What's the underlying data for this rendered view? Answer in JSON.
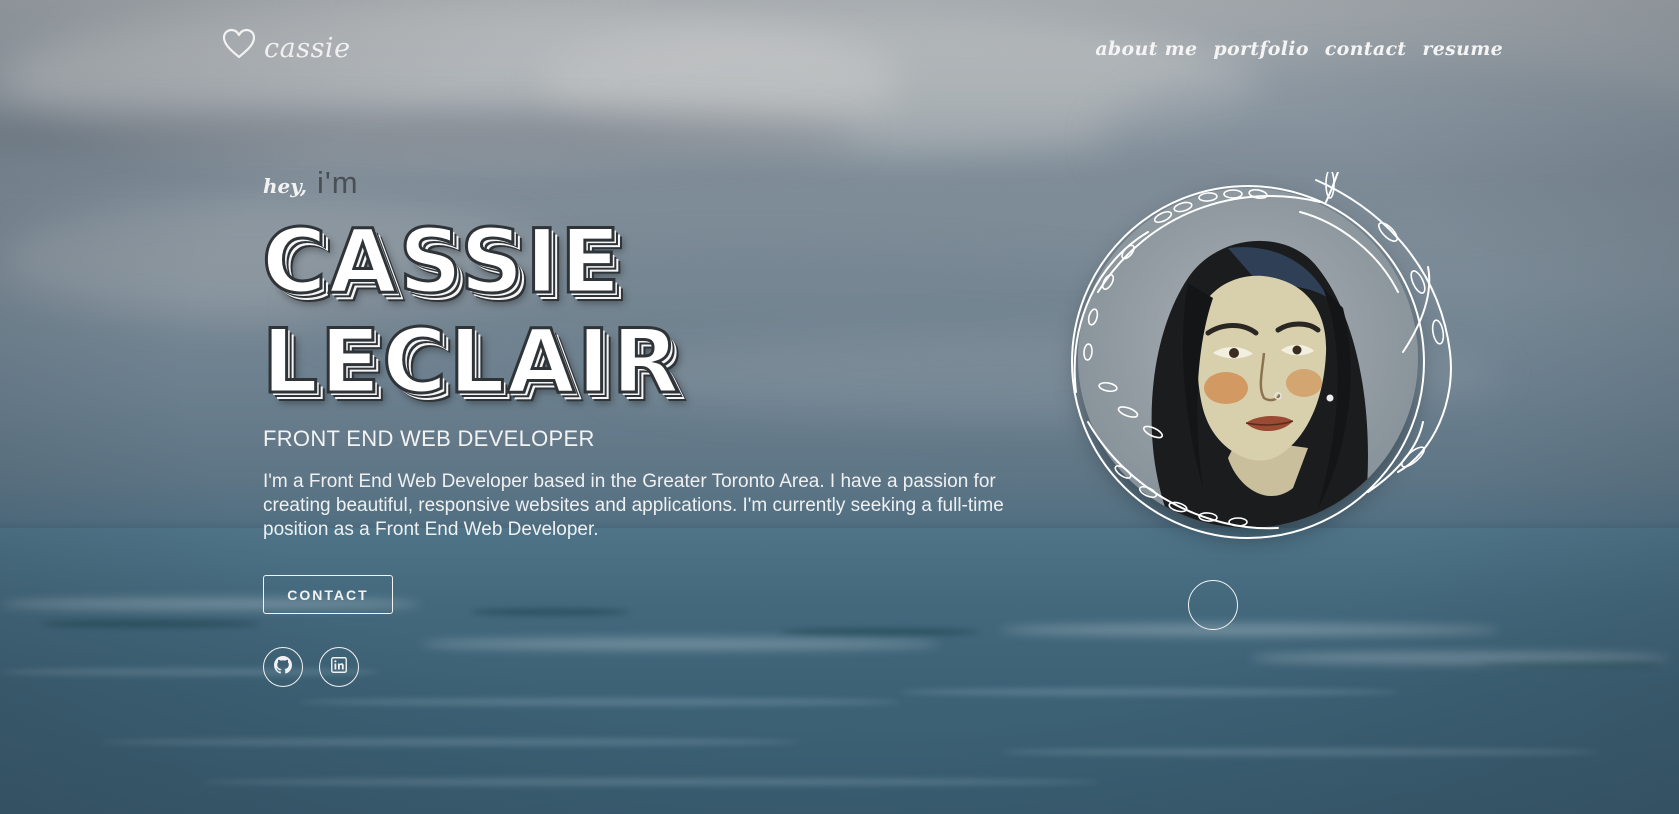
{
  "header": {
    "logo_icon": "heart-outline-icon",
    "logo_text": "cassie",
    "nav": [
      {
        "label": "about me"
      },
      {
        "label": "portfolio"
      },
      {
        "label": "contact"
      },
      {
        "label": "resume"
      }
    ]
  },
  "hero": {
    "greeting_small": "hey,",
    "greeting_im": "i'm",
    "name_line_1": "CASSIE",
    "name_line_2": "LECLAIR",
    "role": "FRONT END WEB DEVELOPER",
    "bio": "I'm a Front End Web Developer based in the Greater Toronto Area. I have a passion for creating beautiful, responsive websites and applications. I'm currently seeking a full-time position as a Front End Web Developer.",
    "contact_button": "CONTACT",
    "social": [
      {
        "icon": "github-icon"
      },
      {
        "icon": "linkedin-icon"
      }
    ]
  },
  "portrait": {
    "image": "illustrated-portrait",
    "frame": "floral-wreath-outline"
  },
  "colors": {
    "text_light": "#f2f2f2",
    "outline_dark": "#2f3438",
    "im_text": "#4a4f55",
    "sea": "#3d6276",
    "sky": "#9aa3aa"
  }
}
